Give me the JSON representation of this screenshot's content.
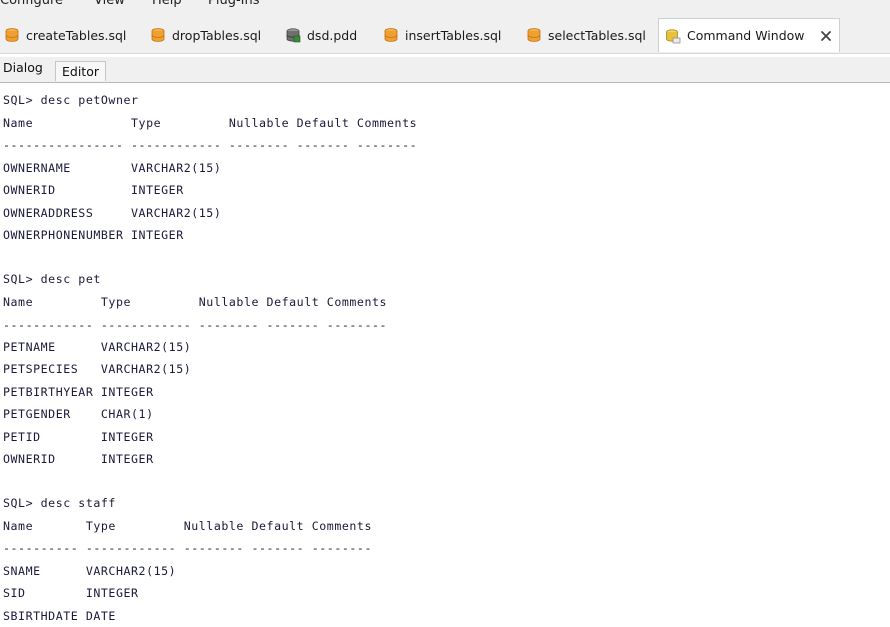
{
  "menubar": {
    "items": [
      "Configure",
      "View",
      "Help",
      "Plug-Ins"
    ]
  },
  "tabs": [
    {
      "label": "createTables.sql",
      "icon": "sql-file-icon"
    },
    {
      "label": "dropTables.sql",
      "icon": "sql-file-icon"
    },
    {
      "label": "dsd.pdd",
      "icon": "database-diagram-icon"
    },
    {
      "label": "insertTables.sql",
      "icon": "sql-file-icon"
    },
    {
      "label": "selectTables.sql",
      "icon": "sql-file-icon"
    },
    {
      "label": "Command Window",
      "icon": "command-window-icon",
      "active": true
    }
  ],
  "subtabs": {
    "dialog": "Dialog",
    "editor": "Editor"
  },
  "console": {
    "lines": [
      "SQL> desc petOwner",
      "Name             Type         Nullable Default Comments",
      "---------------- ------------ -------- ------- --------",
      "OWNERNAME        VARCHAR2(15)",
      "OWNERID          INTEGER",
      "OWNERADDRESS     VARCHAR2(15)",
      "OWNERPHONENUMBER INTEGER",
      "",
      "SQL> desc pet",
      "Name         Type         Nullable Default Comments",
      "------------ ------------ -------- ------- --------",
      "PETNAME      VARCHAR2(15)",
      "PETSPECIES   VARCHAR2(15)",
      "PETBIRTHYEAR INTEGER",
      "PETGENDER    CHAR(1)",
      "PETID        INTEGER",
      "OWNERID      INTEGER",
      "",
      "SQL> desc staff",
      "Name       Type         Nullable Default Comments",
      "---------- ------------ -------- ------- --------",
      "SNAME      VARCHAR2(15)",
      "SID        INTEGER",
      "SBIRTHDATE DATE"
    ]
  },
  "colors": {
    "text": "#1a1a3a",
    "chrome": "#f0f0f0",
    "sql_icon": "#f0a030",
    "active_icon": "#e8c040"
  }
}
